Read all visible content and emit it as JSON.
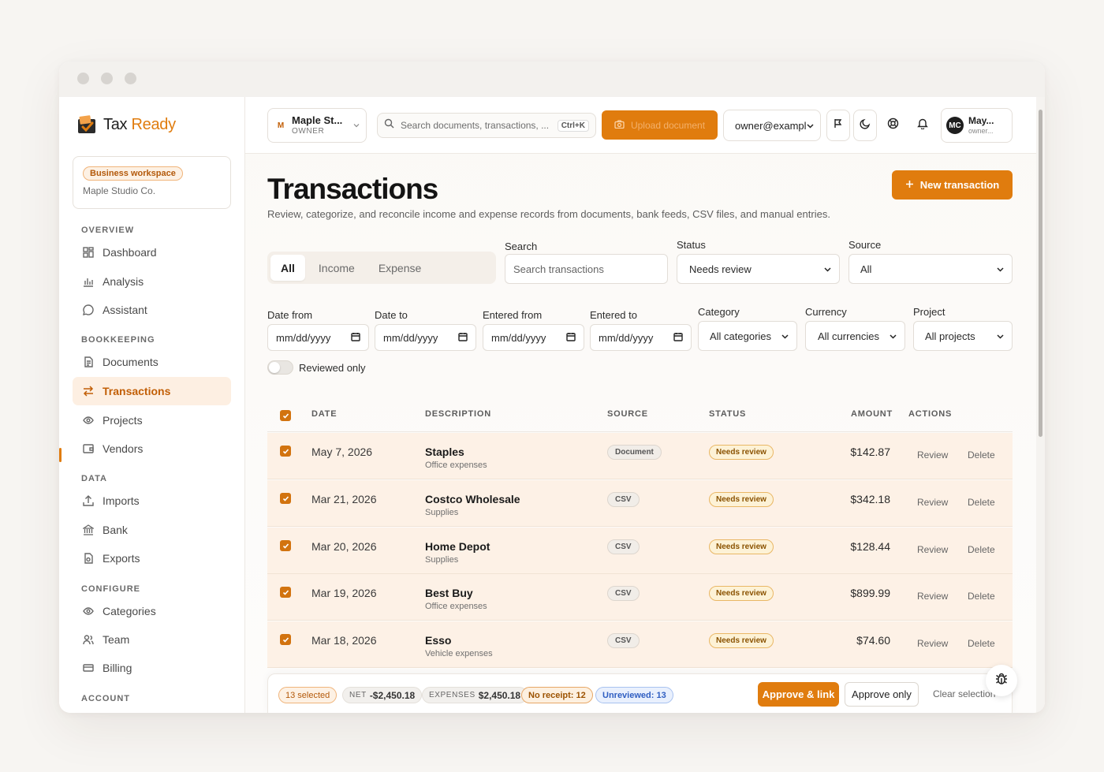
{
  "brand": {
    "name_part1": "Tax",
    "name_part2": "Ready"
  },
  "workspace": {
    "badge": "Business workspace",
    "name": "Maple Studio Co."
  },
  "sidebar": {
    "sections": [
      "OVERVIEW",
      "BOOKKEEPING",
      "DATA",
      "CONFIGURE",
      "ACCOUNT"
    ],
    "items": [
      {
        "label": "Dashboard",
        "icon": "dashboard-icon"
      },
      {
        "label": "Analysis",
        "icon": "analysis-icon"
      },
      {
        "label": "Assistant",
        "icon": "chat-bubble-icon"
      },
      {
        "label": "Documents",
        "icon": "document-icon"
      },
      {
        "label": "Transactions",
        "icon": "transactions-arrows-icon",
        "active": true
      },
      {
        "label": "Projects",
        "icon": "eye-icon"
      },
      {
        "label": "Vendors",
        "icon": "vendor-icon"
      },
      {
        "label": "Imports",
        "icon": "upload-icon"
      },
      {
        "label": "Bank",
        "icon": "bank-icon"
      },
      {
        "label": "Exports",
        "icon": "export-icon"
      },
      {
        "label": "Categories",
        "icon": "eye-icon"
      },
      {
        "label": "Team",
        "icon": "team-icon"
      },
      {
        "label": "Billing",
        "icon": "card-icon"
      }
    ]
  },
  "topbar": {
    "org": {
      "avatar": "M",
      "name": "Maple St...",
      "role": "OWNER"
    },
    "search_placeholder": "Search documents, transactions, ...",
    "search_shortcut": "Ctrl+K",
    "upload_label": "Upload document",
    "owner_select": "owner@example",
    "user": {
      "initials": "MC",
      "name": "May...",
      "email": "owner..."
    }
  },
  "page": {
    "title": "Transactions",
    "subtitle": "Review, categorize, and reconcile income and expense records from documents, bank feeds, CSV files, and manual entries.",
    "new_button": "New transaction"
  },
  "filters": {
    "tabs": [
      "All",
      "Income",
      "Expense"
    ],
    "active_tab": "All",
    "search": {
      "label": "Search",
      "placeholder": "Search transactions"
    },
    "status": {
      "label": "Status",
      "value": "Needs review"
    },
    "source": {
      "label": "Source",
      "value": "All"
    },
    "date_from": {
      "label": "Date from",
      "value": "mm/dd/yyyy"
    },
    "date_to": {
      "label": "Date to",
      "value": "mm/dd/yyyy"
    },
    "entered_from": {
      "label": "Entered from",
      "value": "mm/dd/yyyy"
    },
    "entered_to": {
      "label": "Entered to",
      "value": "mm/dd/yyyy"
    },
    "category": {
      "label": "Category",
      "value": "All categories"
    },
    "currency": {
      "label": "Currency",
      "value": "All currencies"
    },
    "project": {
      "label": "Project",
      "value": "All projects"
    },
    "reviewed_only": {
      "label": "Reviewed only",
      "checked": false
    }
  },
  "table": {
    "headers": [
      "DATE",
      "DESCRIPTION",
      "SOURCE",
      "STATUS",
      "AMOUNT",
      "ACTIONS"
    ],
    "rows": [
      {
        "date": "May 7, 2026",
        "description": "Staples",
        "category": "Office expenses",
        "source": "Document",
        "status": "Needs review",
        "amount": "$142.87",
        "review": "Review",
        "delete": "Delete"
      },
      {
        "date": "Mar 21, 2026",
        "description": "Costco Wholesale",
        "category": "Supplies",
        "source": "CSV",
        "status": "Needs review",
        "amount": "$342.18",
        "review": "Review",
        "delete": "Delete"
      },
      {
        "date": "Mar 20, 2026",
        "description": "Home Depot",
        "category": "Supplies",
        "source": "CSV",
        "status": "Needs review",
        "amount": "$128.44",
        "review": "Review",
        "delete": "Delete"
      },
      {
        "date": "Mar 19, 2026",
        "description": "Best Buy",
        "category": "Office expenses",
        "source": "CSV",
        "status": "Needs review",
        "amount": "$899.99",
        "review": "Review",
        "delete": "Delete"
      },
      {
        "date": "Mar 18, 2026",
        "description": "Esso",
        "category": "Vehicle expenses",
        "source": "CSV",
        "status": "Needs review",
        "amount": "$74.60",
        "review": "Review",
        "delete": "Delete"
      }
    ]
  },
  "bulk": {
    "selected": "13 selected",
    "net_label": "NET",
    "net_value": "-$2,450.18",
    "expenses_label": "EXPENSES",
    "expenses_value": "$2,450.18",
    "no_receipt": "No receipt: 12",
    "unreviewed": "Unreviewed: 13",
    "approve_link": "Approve & link",
    "approve_only": "Approve only",
    "clear": "Clear selection"
  },
  "colors": {
    "accent": "#e07c0e",
    "row_highlight": "#fdf1e6",
    "info": "#2f5ec2"
  }
}
